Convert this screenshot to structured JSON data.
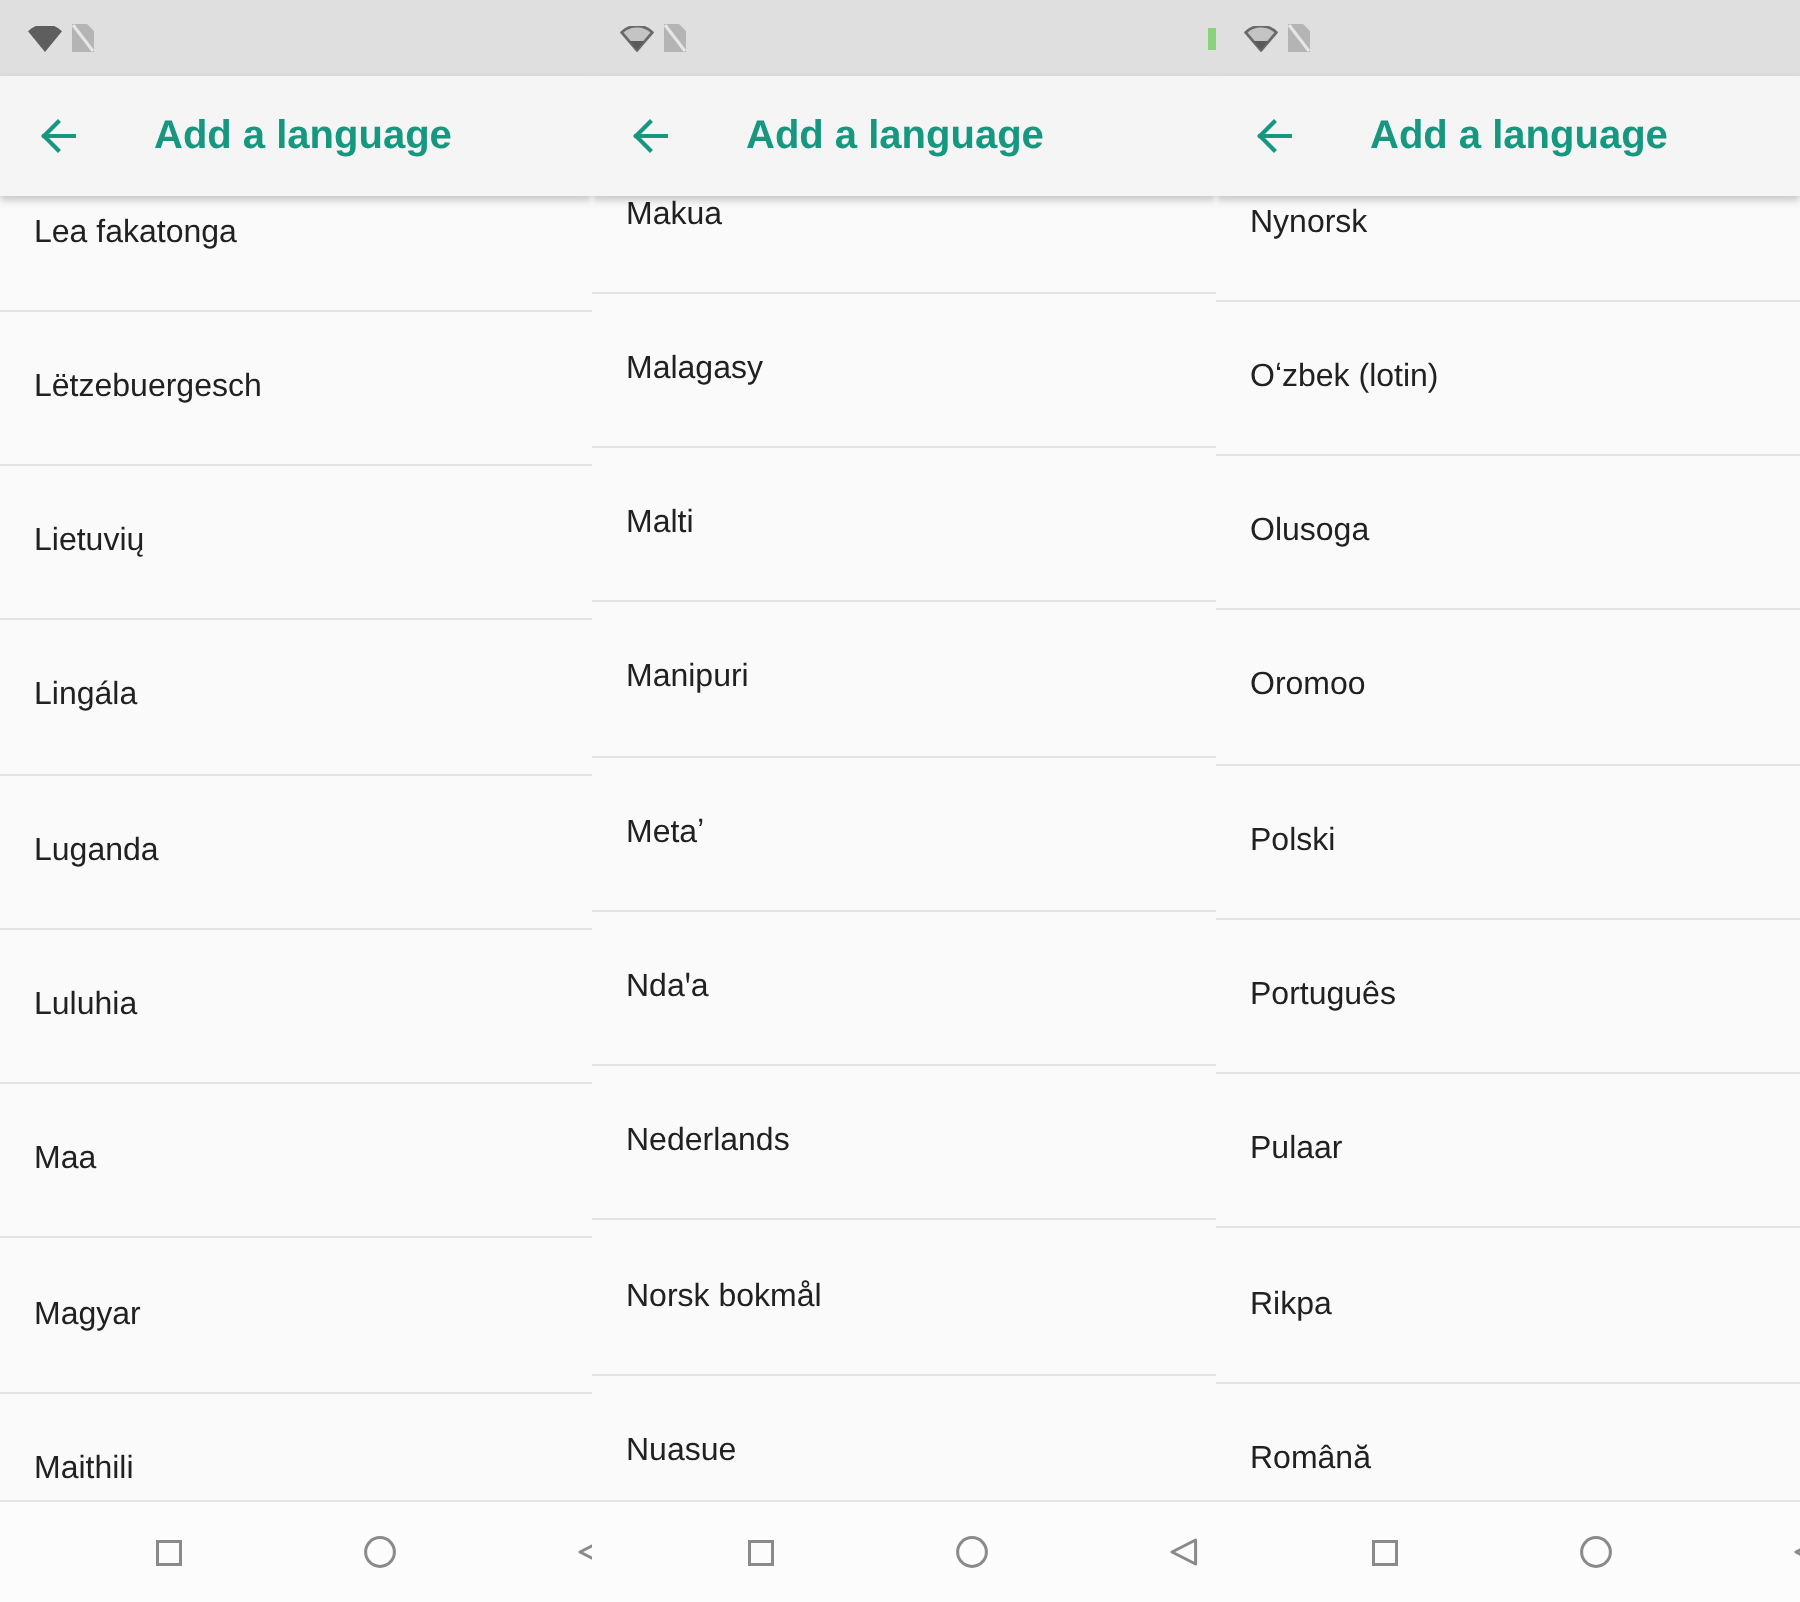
{
  "panels": [
    {
      "status_bar": {
        "wifi_limited": false,
        "battery_shown": false
      },
      "app_bar": {
        "title": "Add a language"
      },
      "languages": [
        "Lea fakatonga",
        "Lëtzebuergesch",
        "Lietuvių",
        "Lingála",
        "Luganda",
        "Luluhia",
        "Maa",
        "Magyar",
        "Maithili"
      ]
    },
    {
      "status_bar": {
        "wifi_limited": true,
        "battery_shown": true
      },
      "app_bar": {
        "title": "Add a language"
      },
      "languages": [
        "Makua",
        "Malagasy",
        "Malti",
        "Manipuri",
        "Metaʼ",
        "Ndaꞌa",
        "Nederlands",
        "Norsk bokmål",
        "Nuasue"
      ]
    },
    {
      "status_bar": {
        "wifi_limited": true,
        "battery_shown": false
      },
      "app_bar": {
        "title": "Add a language"
      },
      "languages": [
        "Nynorsk",
        "Oʻzbek (lotin)",
        "Olusoga",
        "Oromoo",
        "Polski",
        "Português",
        "Pulaar",
        "Rikpa",
        "Română"
      ]
    }
  ]
}
